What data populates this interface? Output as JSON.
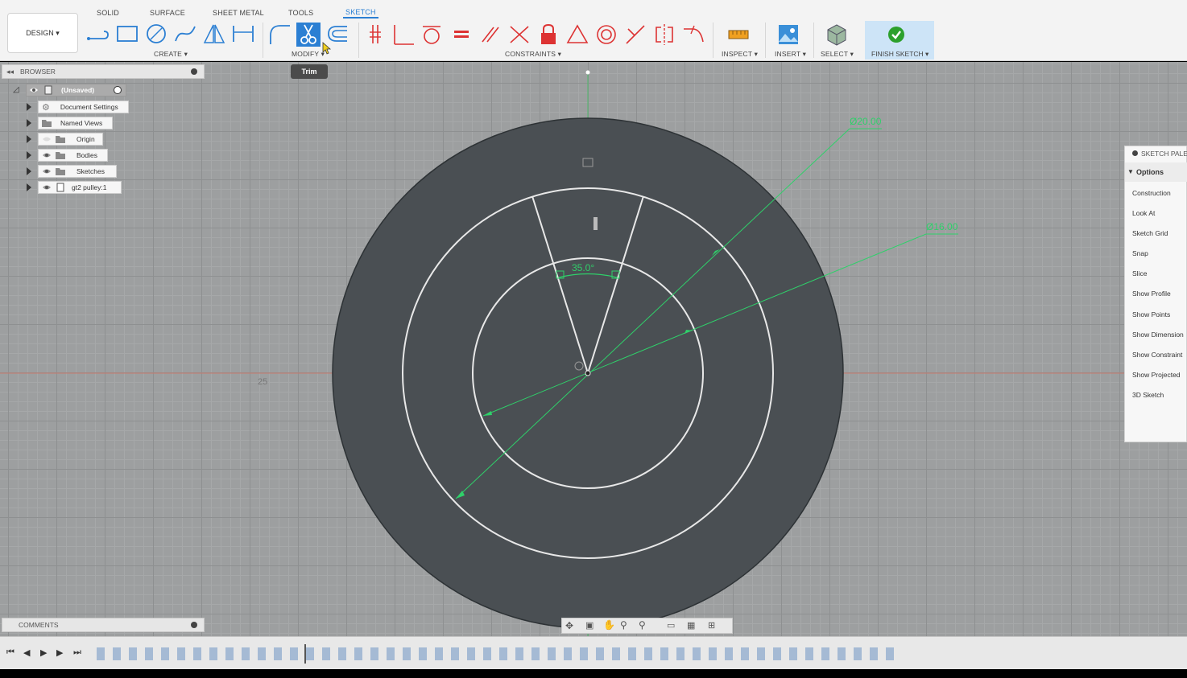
{
  "tabs": [
    "SOLID",
    "SURFACE",
    "SHEET METAL",
    "TOOLS",
    "SKETCH"
  ],
  "design_label": "DESIGN ▾",
  "groups": {
    "create": "CREATE ▾",
    "modify": "MODIFY ▾",
    "constraints": "CONSTRAINTS ▾",
    "inspect": "INSPECT ▾",
    "insert": "INSERT ▾",
    "select": "SELECT ▾",
    "finish": "FINISH SKETCH ▾"
  },
  "tooltip": "Trim",
  "browser": {
    "title": "BROWSER",
    "items": [
      "(Unsaved)",
      "Document Settings",
      "Named Views",
      "Origin",
      "Bodies",
      "Sketches",
      "gt2 pulley:1"
    ]
  },
  "comments": "COMMENTS",
  "palette": {
    "title": "SKETCH PALE",
    "section": "Options",
    "items": [
      "Construction",
      "Look At",
      "Sketch Grid",
      "Snap",
      "Slice",
      "Show Profile",
      "Show Points",
      "Show Dimension",
      "Show Constraint",
      "Show Projected",
      "3D Sketch"
    ]
  },
  "dimensions": {
    "outer": "Ø20.00",
    "inner": "Ø16.00",
    "angle": "35.0°",
    "axis": "25"
  },
  "colors": {
    "accent": "#2b7fd3",
    "dimension": "#2fd06a",
    "sketch_line": "#e8e8e8",
    "profile": "#4a4f53"
  }
}
